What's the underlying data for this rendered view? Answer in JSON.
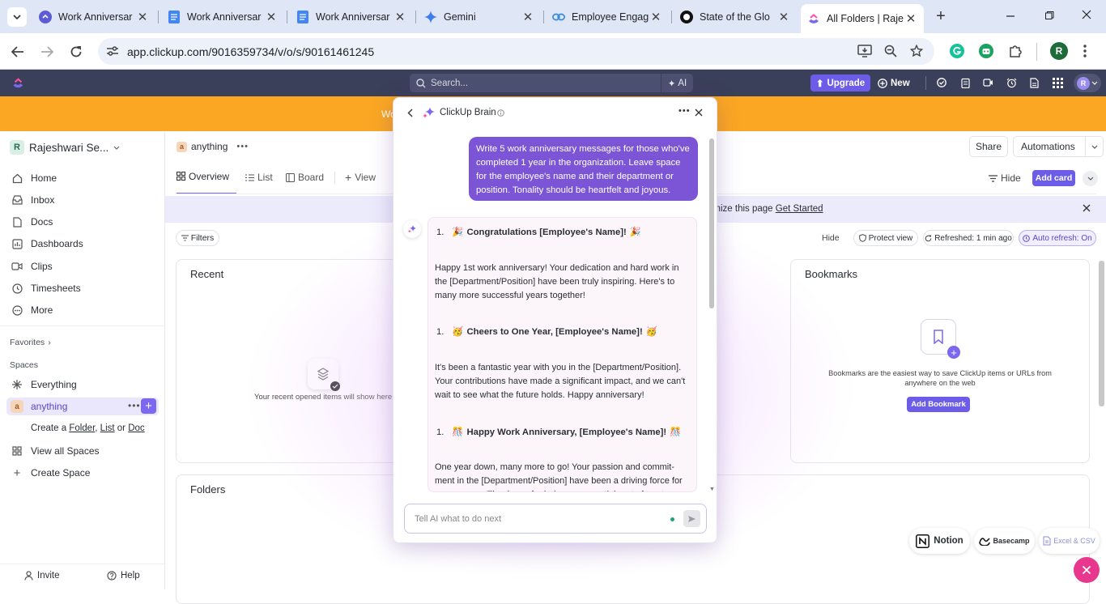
{
  "browser": {
    "tabs": [
      {
        "title": "Work Anniversar",
        "icon": "clickup-icon"
      },
      {
        "title": "Work Anniversar",
        "icon": "docs-icon"
      },
      {
        "title": "Work Anniversar",
        "icon": "docs-icon"
      },
      {
        "title": "Gemini",
        "icon": "gemini-icon"
      },
      {
        "title": "Employee Engag",
        "icon": "link-icon"
      },
      {
        "title": "State of the Glo",
        "icon": "github-icon"
      },
      {
        "title": "All Folders | Raje",
        "icon": "clickup-icon",
        "active": true
      }
    ],
    "url": "app.clickup.com/9016359734/v/o/s/90161461245",
    "profile_initial": "R"
  },
  "topbar": {
    "search_placeholder": "Search...",
    "ai_label": "AI",
    "upgrade_label": "Upgrade",
    "new_label": "New",
    "avatar_initial": "R"
  },
  "banner": {
    "text": "Wo"
  },
  "sidebar": {
    "workspace_initial": "R",
    "workspace_name": "Rajeshwari Se...",
    "items": [
      {
        "label": "Home",
        "icon": "home-icon"
      },
      {
        "label": "Inbox",
        "icon": "inbox-icon"
      },
      {
        "label": "Docs",
        "icon": "docs-icon"
      },
      {
        "label": "Dashboards",
        "icon": "dashboard-icon"
      },
      {
        "label": "Clips",
        "icon": "clips-icon"
      },
      {
        "label": "Timesheets",
        "icon": "timesheet-icon"
      },
      {
        "label": "More",
        "icon": "more-icon"
      }
    ],
    "favorites_label": "Favorites",
    "spaces_label": "Spaces",
    "everything_label": "Everything",
    "space_initial": "a",
    "space_name": "anything",
    "create_prefix": "Create a ",
    "create_folder": "Folder",
    "create_sep1": ", ",
    "create_list": "List",
    "create_sep2": " or ",
    "create_doc": "Doc",
    "view_all_spaces": "View all Spaces",
    "create_space": "Create Space",
    "invite_label": "Invite",
    "help_label": "Help"
  },
  "main": {
    "space_initial": "a",
    "space_name": "anything",
    "share_label": "Share",
    "automations_label": "Automations",
    "tabs": {
      "overview": "Overview",
      "list": "List",
      "board": "Board",
      "view": "View"
    },
    "hide_label": "Hide",
    "add_card_label": "Add card",
    "customize_text": "omize this page ",
    "get_started": "Get Started",
    "filters_label": "Filters",
    "hide2_label": "Hide",
    "protect_view": "Protect view",
    "refreshed": "Refreshed: 1 min ago",
    "auto_refresh": "Auto refresh: On",
    "recent_title": "Recent",
    "recent_empty": "Your recent opened items will show here",
    "bookmarks_title": "Bookmarks",
    "bookmarks_desc_1": "Bookmarks are the easiest way to save ClickUp items or URLs from",
    "bookmarks_desc_2": "anywhere on the web",
    "add_bookmark": "Add Bookmark",
    "folders_title": "Folders"
  },
  "integrations": {
    "notion": "Notion",
    "basecamp": "Basecamp",
    "excel": "Excel & CSV"
  },
  "brain": {
    "title": "ClickUp Brain",
    "user_message": "Write 5 work anniversary messages for those who've completed 1 year in the organization. Leave space for the employee's name and their department or position. Tonality should be heartfelt and joyous.",
    "messages": [
      {
        "number": "1.",
        "emoji": "🎉",
        "title": "Congratulations [Employee's Name]!",
        "body": "Happy 1st work anniversary! Your dedication and hard work in the [Department/Position] have been truly inspiring. Here's to many more successful years together!"
      },
      {
        "number": "1.",
        "emoji": "🥳",
        "title": "Cheers to One Year, [Employee's Name]!",
        "body": "It's been a fantastic year with you in the [Department/Position]. Your contributions have made a significant impact, and we can't wait to see what the future holds. Happy anniversary!"
      },
      {
        "number": "1.",
        "emoji": "🎊",
        "title": "Happy Work Anniversary, [Employee's Name]!",
        "body": "One year down, many more to go! Your passion and commit-ment in the [Department/Position] have been a driving force for our success. Thank you for being an essential part of our team."
      }
    ],
    "input_placeholder": "Tell AI what to do next"
  },
  "colors": {
    "accent": "#7b68ee",
    "banner": "#fba723",
    "topbar": "#3a3f5a",
    "bubble": "#7b55d6"
  }
}
